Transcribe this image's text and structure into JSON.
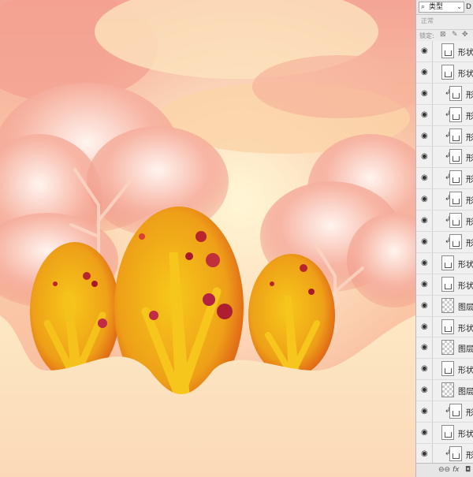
{
  "layers_panel": {
    "filter": {
      "label": "类型",
      "search_icon": "search-icon",
      "extra": "D"
    },
    "blend_mode": "正常",
    "lock_label": "锁定:",
    "layers": [
      {
        "name": "形状",
        "thumb": "shape",
        "clipped": false,
        "indent": false
      },
      {
        "name": "形状",
        "thumb": "shape",
        "clipped": false,
        "indent": false
      },
      {
        "name": "形",
        "thumb": "shape",
        "clipped": true,
        "indent": true
      },
      {
        "name": "形",
        "thumb": "shape",
        "clipped": true,
        "indent": true
      },
      {
        "name": "形",
        "thumb": "shape",
        "clipped": true,
        "indent": true
      },
      {
        "name": "形",
        "thumb": "shape",
        "clipped": true,
        "indent": true
      },
      {
        "name": "形",
        "thumb": "shape",
        "clipped": true,
        "indent": true
      },
      {
        "name": "形",
        "thumb": "shape",
        "clipped": true,
        "indent": true
      },
      {
        "name": "形",
        "thumb": "shape",
        "clipped": true,
        "indent": true
      },
      {
        "name": "形",
        "thumb": "shape",
        "clipped": true,
        "indent": true
      },
      {
        "name": "形状",
        "thumb": "shape",
        "clipped": false,
        "indent": false
      },
      {
        "name": "形状",
        "thumb": "shape",
        "clipped": false,
        "indent": false
      },
      {
        "name": "图层",
        "thumb": "transparent",
        "clipped": false,
        "indent": false
      },
      {
        "name": "形状",
        "thumb": "shape",
        "clipped": false,
        "indent": false
      },
      {
        "name": "图层",
        "thumb": "transparent",
        "clipped": false,
        "indent": false
      },
      {
        "name": "形状",
        "thumb": "shape",
        "clipped": false,
        "indent": false
      },
      {
        "name": "图层",
        "thumb": "transparent",
        "clipped": false,
        "indent": false
      },
      {
        "name": "形",
        "thumb": "shape",
        "clipped": true,
        "indent": true
      },
      {
        "name": "形状",
        "thumb": "shape",
        "clipped": false,
        "indent": false
      },
      {
        "name": "形",
        "thumb": "shape",
        "clipped": true,
        "indent": true
      },
      {
        "name": "形状",
        "thumb": "shape",
        "clipped": false,
        "indent": false
      }
    ],
    "bottom_icons": [
      "link-icon",
      "fx-icon",
      "mask-icon"
    ],
    "bottom_labels": {
      "link": "⊖⊖",
      "fx": "fx",
      "mask": "◘"
    }
  },
  "colors": {
    "sky_top": "#f7b7a3",
    "sky_glow": "#fff1c8",
    "ground": "#fde6c0",
    "egg_yellow": "#f5c414",
    "egg_orange": "#e56a12",
    "egg_red": "#c52b2b"
  }
}
